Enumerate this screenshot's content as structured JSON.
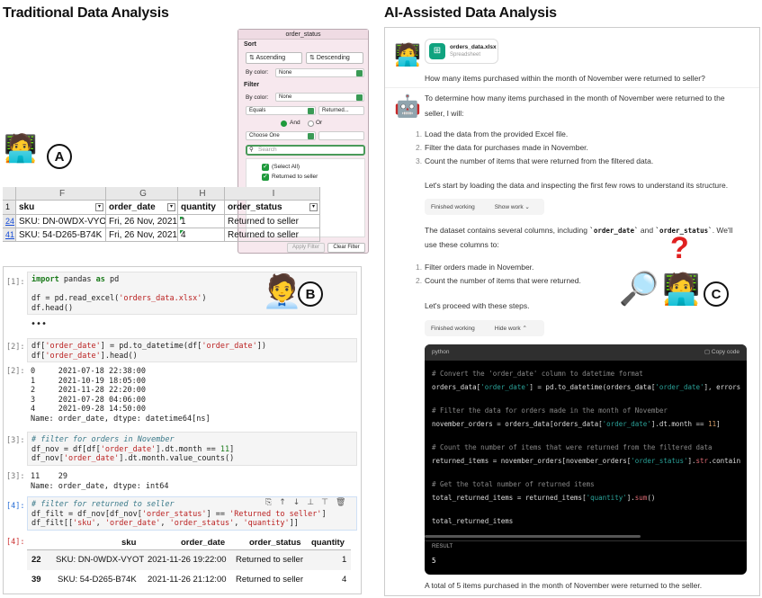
{
  "left_title": "Traditional Data Analysis",
  "right_title": "AI-Assisted Data Analysis",
  "labels": {
    "a": "A",
    "b": "B",
    "c": "C"
  },
  "question_mark": "?",
  "dialog": {
    "title": "order_status",
    "sort_label": "Sort",
    "ascending": "Ascending",
    "descending": "Descending",
    "by_color_label": "By color:",
    "by_color_value": "None",
    "filter_label": "Filter",
    "filter_by_color_label": "By color:",
    "filter_by_color_value": "None",
    "condition": "Equals",
    "condition_value": "Returned...",
    "and_label": "And",
    "or_label": "Or",
    "choose_one": "Choose One",
    "search_placeholder": "Search",
    "select_all": "(Select All)",
    "returned_to_seller": "Returned to seller",
    "apply_filter": "Apply Filter",
    "clear_filter": "Clear Filter"
  },
  "sheet": {
    "col_letters": [
      "F",
      "G",
      "H",
      "I"
    ],
    "headers": [
      "sku",
      "order_date",
      "quantity",
      "order_status"
    ],
    "header_row_num": "1",
    "rows": [
      {
        "num": "24",
        "sku": "SKU: DN-0WDX-VYOT",
        "date": "Fri, 26 Nov, 2021,",
        "qty": "1",
        "status": "Returned to seller"
      },
      {
        "num": "41",
        "sku": "SKU: 54-D265-B74K",
        "date": "Fri, 26 Nov, 2021,",
        "qty": "4",
        "status": "Returned to seller"
      }
    ]
  },
  "notebook": {
    "cells": [
      {
        "prompt": "[1]:"
      },
      {
        "prompt": "[2]:"
      },
      {
        "prompt": "[3]:"
      },
      {
        "prompt": "[4]:"
      }
    ],
    "out_prompts": [
      "[2]:",
      "[3]:",
      "[4]:"
    ],
    "ellipsis": "•••",
    "out2": "0     2021-07-18 22:38:00\n1     2021-10-19 18:05:00\n2     2021-11-28 22:20:00\n3     2021-07-28 04:06:00\n4     2021-09-28 14:50:00\nName: order_date, dtype: datetime64[ns]",
    "out3": "11    29\nName: order_date, dtype: int64",
    "table": {
      "headers": [
        "sku",
        "order_date",
        "order_status",
        "quantity"
      ],
      "rows": [
        {
          "idx": "22",
          "sku": "SKU: DN-0WDX-VYOT",
          "date": "2021-11-26 19:22:00",
          "status": "Returned to seller",
          "qty": "1"
        },
        {
          "idx": "39",
          "sku": "SKU: 54-D265-B74K",
          "date": "2021-11-26 21:12:00",
          "status": "Returned to seller",
          "qty": "4"
        }
      ]
    }
  },
  "chat": {
    "file_name": "orders_data.xlsx",
    "file_type": "Spreadsheet",
    "user_question": "How many items purchased within the month of November were returned to seller?",
    "intro": "To determine how many items purchased in the month of November were returned to the seller, I will:",
    "steps1": [
      "Load the data from the provided Excel file.",
      "Filter the data for purchases made in November.",
      "Count the number of items that were returned from the filtered data."
    ],
    "start": "Let's start by loading the data and inspecting the first few rows to understand its structure.",
    "finished_working": "Finished working",
    "show_work": "Show work",
    "dataset_line1": "The dataset contains several columns, including",
    "col_a": "`order_date`",
    "and_word": "and",
    "col_b": "`order_status`",
    "dataset_line1_end": ". We'll",
    "dataset_line2": "use these columns to:",
    "steps2": [
      "Filter orders made in November.",
      "Count the number of items that were returned."
    ],
    "proceed": "Let's proceed with these steps.",
    "finished_working2": "Finished working",
    "hide_work": "Hide work",
    "code_lang": "python",
    "copy_code": "Copy code",
    "result_label": "RESULT",
    "result_value": "5",
    "final": "A total of 5 items purchased in the month of November were returned to the seller."
  },
  "colors": {
    "accent_green": "#1f9a3c",
    "code_bg": "#000000",
    "dialog_bg": "#f7e8ee"
  }
}
